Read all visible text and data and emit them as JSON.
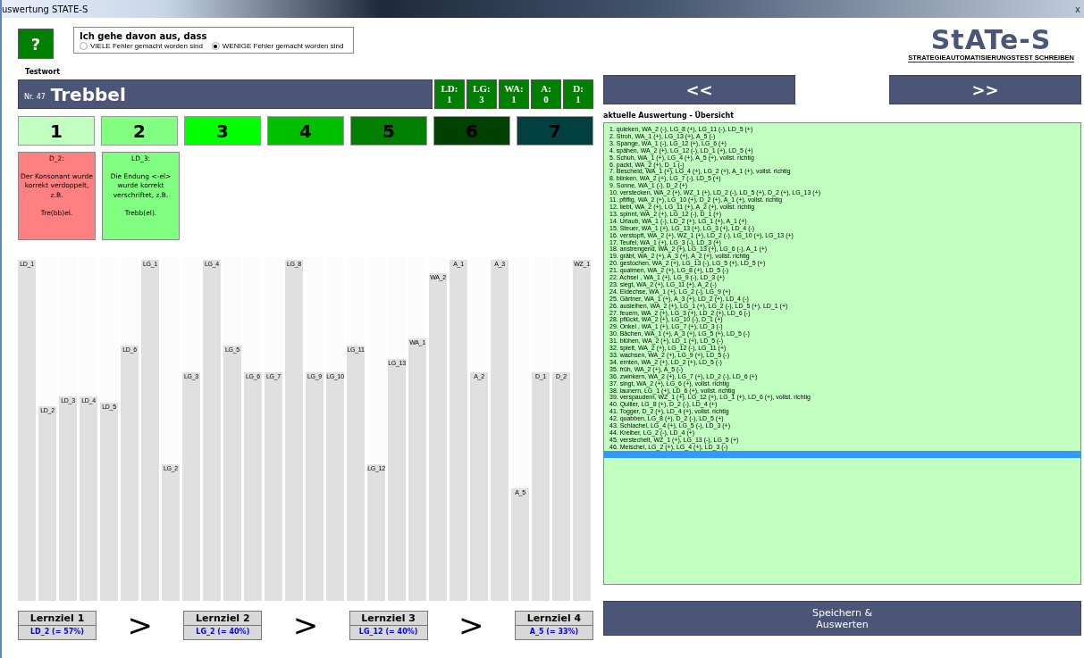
{
  "window": {
    "title": "uswertung STATE-S",
    "close": "x"
  },
  "help_button": "?",
  "assumption": {
    "title": "Ich gehe davon aus, dass",
    "options": [
      {
        "label": "VIELE Fehler gemacht worden sind",
        "selected": false
      },
      {
        "label": "WENIGE Fehler gemacht worden sind",
        "selected": true
      }
    ]
  },
  "logo": {
    "text": "StATe-S",
    "subtitle": "STRATEGIEAUTOMATISIERUNGSTEST SCHREIBEN"
  },
  "testword": {
    "label": "Testwort",
    "number": "Nr. 47",
    "word": "Trebbel"
  },
  "scores": [
    {
      "label": "LD:",
      "value": "1"
    },
    {
      "label": "LG:",
      "value": "3"
    },
    {
      "label": "WA:",
      "value": "1"
    },
    {
      "label": "A:",
      "value": "0"
    },
    {
      "label": "D:",
      "value": "1"
    }
  ],
  "nav": {
    "prev": "<<",
    "next": ">>"
  },
  "levels": [
    {
      "label": "1",
      "color": "#c0ffc0"
    },
    {
      "label": "2",
      "color": "#80ff80"
    },
    {
      "label": "3",
      "color": "#00ff00"
    },
    {
      "label": "4",
      "color": "#00c000"
    },
    {
      "label": "5",
      "color": "#008000"
    },
    {
      "label": "6",
      "color": "#004000"
    },
    {
      "label": "7",
      "color": "#004040"
    }
  ],
  "cards": [
    {
      "title": "D_2:",
      "text": "Der Konsonant wurde korrekt verdoppelt, z.B.\n\nTre(bb)el.",
      "color": "#ff8080"
    },
    {
      "title": "LD_3:",
      "text": "Die Endung <-el>\nwurde korrekt\nverschriftet, z.B.\n\nTrebb(el).",
      "color": "#80ff80"
    }
  ],
  "bars": [
    {
      "label": "LD_1",
      "level": 1
    },
    {
      "label": "LD_2",
      "level": 0.57
    },
    {
      "label": "LD_3",
      "level": 0.6
    },
    {
      "label": "LD_4",
      "level": 0.6
    },
    {
      "label": "LD_5",
      "level": 0.58
    },
    {
      "label": "LD_6",
      "level": 0.75
    },
    {
      "label": "LG_1",
      "level": 1
    },
    {
      "label": "LG_2",
      "level": 0.4
    },
    {
      "label": "LG_3",
      "level": 0.67
    },
    {
      "label": "LG_4",
      "level": 1
    },
    {
      "label": "LG_5",
      "level": 0.75
    },
    {
      "label": "LG_6",
      "level": 0.67
    },
    {
      "label": "LG_7",
      "level": 0.67
    },
    {
      "label": "LG_8",
      "level": 1
    },
    {
      "label": "LG_9",
      "level": 0.67
    },
    {
      "label": "LG_10",
      "level": 0.67
    },
    {
      "label": "LG_11",
      "level": 0.75
    },
    {
      "label": "LG_12",
      "level": 0.4
    },
    {
      "label": "LG_13",
      "level": 0.71
    },
    {
      "label": "WA_1",
      "level": 0.77
    },
    {
      "label": "WA_2",
      "level": 0.96
    },
    {
      "label": "A_1",
      "level": 1
    },
    {
      "label": "A_2",
      "level": 0.67
    },
    {
      "label": "A_3",
      "level": 1
    },
    {
      "label": "A_5",
      "level": 0.33
    },
    {
      "label": "D_1",
      "level": 0.67
    },
    {
      "label": "D_2",
      "level": 0.67
    },
    {
      "label": "WZ_1",
      "level": 1
    }
  ],
  "goals": [
    {
      "title": "Lernziel 1",
      "value": "LD_2 (= 57%)"
    },
    {
      "title": "Lernziel 2",
      "value": "LG_2 (= 40%)"
    },
    {
      "title": "Lernziel 3",
      "value": "LG_12 (= 40%)"
    },
    {
      "title": "Lernziel 4",
      "value": "A_5 (= 33%)"
    }
  ],
  "goal_separator": ">",
  "overview": {
    "title": "aktuelle Auswertung - Übersicht",
    "new_entry_selected": true,
    "entries": [
      "1. quieken, WA_2 (-), LG_8 (+), LG_11 (-), LD_5 (+)",
      "2. Stroh, WA_1 (+), LG_13 (+), A_5 (-)",
      "3. Spange, WA_1 (-), LG_12 (+), LG_6 (+)",
      "4. spähen, WA_2 (+), LG_12 (-), LD_1 (+), LD_5 (+)",
      "5. Schuh, WA_1 (+), LG_4 (+), A_5 (+), vollst. richtig",
      "6. packt, WA_2 (+), D_1 (-)",
      "7. Bescheid, WA_1 (+), LG_4 (+), LG_2 (+), A_1 (+), vollst. richtig",
      "8. blinken, WA_2 (+), LG_7 (-), LD_5 (+)",
      "9. Sonne, WA_1 (-), D_2 (+)",
      "10. verstecken, WA_2 (+), WZ_1 (+), LD_2 (-), LD_5 (+), D_2 (+), LG_13 (+)",
      "11. pfiffig, WA_2 (+), LG_10 (+), D_2 (+), A_1 (+), vollst. richtig",
      "12. liebt, WA_2 (+), LG_11 (+), A_2 (+), vollst. richtig",
      "13. spinnt, WA_2 (+), LG_12 (-), D_1 (+)",
      "14. Urlaub, WA_1 (-), LD_2 (+), LG_1 (+), A_1 (+)",
      "15. Steuer, WA_1 (+), LG_13 (+), LG_3 (+), LD_4 (-)",
      "16. verstopft, WA_2 (+), WZ_1 (+), LD_2 (-), LG_10 (+), LG_13 (+)",
      "17. Teufel, WA_1 (+), LG_3 (-), LD_3 (+)",
      "18. anstrengend, WA_2 (+), LG_13 (+), LG_6 (-), A_1 (+)",
      "19. gräbt, WA_2 (+), A_3 (+), A_2 (+), vollst. richtig",
      "20. gestochen, WA_2 (+), LG_13 (-), LG_5 (+), LD_5 (+)",
      "21. qualmen, WA_2 (+), LG_8 (+), LD_5 (-)",
      "22. Achsel , WA_1 (+), LG_9 (-), LD_3 (+)",
      "23. siegt, WA_2 (+), LG_11 (+), A_2 (-)",
      "24. Eidechse, WA_1 (+), LG_2 (-), LG_9 (+)",
      "25. Gärtner, WA_1 (+), A_3 (+), LD_2 (+), LD_4 (-)",
      "26. ausleihen, WA_2 (+), LG_1 (+), LG_2 (-), LD_5 (+), LD_1 (+)",
      "27. feuern, WA_2 (+), LG_3 (+), LD_2 (+), LD_6 (-)",
      "28. pflückt, WA_2 (+), LG_10 (-), D_1 (+)",
      "29. Onkel , WA_1 (+), LG_7 (+), LD_3 (-)",
      "30. Bächen, WA_1 (+), A_3 (+), LG_5 (+), LD_5 (-)",
      "31. blühen, WA_2 (+), LD_1 (+), LD_5 (-)",
      "32. spielt, WA_2 (+), LG_12 (-), LG_11 (+)",
      "33. wachsen, WA_2 (+), LG_9 (+), LD_5 (-)",
      "34. ernten, WA_2 (+), LD_2 (+), LD_5 (-)",
      "35. früh, WA_2 (+), A_5 (-)",
      "36. zwinkern, WA_2 (+), LG_7 (+), LD_2 (-), LD_6 (+)",
      "37. singt, WA_2 (+), LG_6 (+), vollst. richtig",
      "38. launern, LG_1 (+), LD_6 (+), vollst. richtig",
      "39. verspaudern, WZ_1 (+), LG_12 (+), LG_1 (+), LD_6 (+), vollst. richtig",
      "40. Quiller, LG_8 (+), D_2 (-), LD_4 (+)",
      "41. Togger, D_2 (+), LD_4 (+), vollst. richtig",
      "42. quabben, LG_8 (+), D_2 (-), LD_5 (+)",
      "43. Schlachel, LG_4 (+), LG_5 (-), LD_3 (+)",
      "44. Kreiber, LG_2 (-), LD_4 (+)",
      "45. verstechelt, WZ_1 (+), LG_13 (-), LG_5 (+)",
      "46. Meischel, LG_2 (+), LG_4 (+), LD_3 (-)"
    ]
  },
  "save_button": "Speichern &\nAuswerten"
}
